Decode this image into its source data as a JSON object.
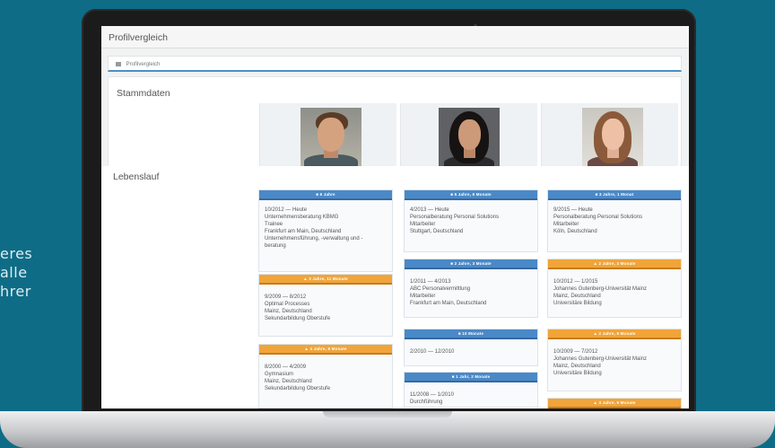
{
  "side_text": [
    "eres",
    "alle",
    "hrer"
  ],
  "app": {
    "title": "Profilvergleich",
    "breadcrumb": "Profilvergleich"
  },
  "stammdaten": {
    "title": "Stammdaten"
  },
  "lebenslauf": {
    "title": "Lebenslauf",
    "columns": [
      [
        {
          "head": "6 Jahre",
          "color": "blue",
          "lines": [
            "10/2012 — Heute",
            "Unternehmensberatung KBMG",
            "Trainee",
            "Frankfurt am Main, Deutschland",
            "Unternehmensführung, -verwaltung und -",
            "beratung"
          ]
        },
        {
          "head": "3 Jahre, 11 Monate",
          "color": "orange",
          "lines": [
            "9/2009 — 8/2012",
            "Optimal Processes",
            "Mainz, Deutschland",
            "Sekundarbildung Oberstufe"
          ]
        },
        {
          "head": "4 Jahre, 8 Monate",
          "color": "orange",
          "lines": [
            "8/2000 — 4/2009",
            "Gymnasium",
            "Mainz, Deutschland",
            "Sekundarbildung Oberstufe"
          ]
        }
      ],
      [
        {
          "head": "5 Jahre, 6 Monate",
          "color": "blue",
          "lines": [
            "4/2013 — Heute",
            "Personalberatung Personal Solutions",
            "Mitarbeiter",
            "Stuttgart, Deutschland"
          ]
        },
        {
          "head": "2 Jahre, 3 Monate",
          "color": "blue",
          "lines": [
            "1/2011 — 4/2013",
            "ABC Personalvermittlung",
            "Mitarbeiter",
            "Frankfurt am Main, Deutschland"
          ]
        },
        {
          "head": "10 Monate",
          "color": "blue",
          "lines": [
            "2/2010 — 12/2010"
          ]
        },
        {
          "head": "1 Jahr, 2 Monate",
          "color": "blue",
          "lines": [
            "11/2008 — 1/2010",
            "Durchführung"
          ]
        }
      ],
      [
        {
          "head": "3 Jahre, 1 Monat",
          "color": "blue",
          "lines": [
            "9/2015 — Heute",
            "Personalberatung Personal Solutions",
            "Mitarbeiter",
            "Köln, Deutschland"
          ]
        },
        {
          "head": "2 Jahre, 3 Monate",
          "color": "orange",
          "lines": [
            "10/2012 — 1/2015",
            "Johannes Gutenberg-Universität Mainz",
            "Mainz, Deutschland",
            "Universitäre Bildung"
          ]
        },
        {
          "head": "2 Jahre, 9 Monate",
          "color": "orange",
          "lines": [
            "10/2009 — 7/2012",
            "Johannes Gutenberg-Universität Mainz",
            "Mainz, Deutschland",
            "Universitäre Bildung"
          ]
        },
        {
          "head": "3 Jahre, 9 Monate",
          "color": "orange",
          "lines": []
        }
      ]
    ]
  },
  "colors": {
    "background": "#0f6c86",
    "blue_head": "#4a89c8",
    "orange_head": "#f0a43a"
  },
  "icons": [
    "home-icon",
    "briefcase-icon",
    "graduation-cap-icon"
  ]
}
